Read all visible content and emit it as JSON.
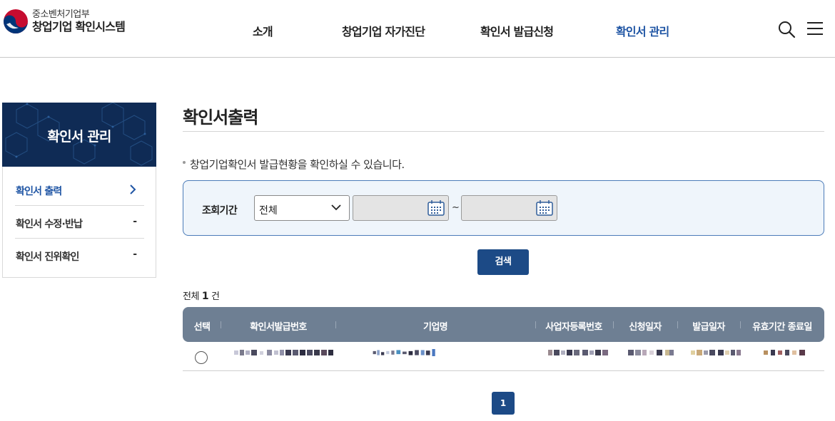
{
  "header": {
    "org_name": "중소벤처기업부",
    "site_name": "창업기업 확인시스템",
    "nav": [
      {
        "label": "소개"
      },
      {
        "label": "창업기업 자가진단"
      },
      {
        "label": "확인서 발급신청"
      },
      {
        "label": "확인서 관리",
        "active": true
      }
    ],
    "icons": [
      "search-icon",
      "menu-icon"
    ],
    "accent_color": "#1f55a4"
  },
  "sidebar": {
    "title": "확인서 관리",
    "items": [
      {
        "label": "확인서 출력",
        "active": true,
        "icon": "chevron-right-icon"
      },
      {
        "label": "확인서 수정·반납",
        "mark": "-"
      },
      {
        "label": "확인서 진위확인",
        "mark": "-"
      }
    ]
  },
  "main": {
    "title": "확인서출력",
    "description": "창업기업확인서 발급현황을 확인하실 수 있습니다.",
    "search": {
      "period_label": "조회기간",
      "period_select_value": "전체",
      "date_from": "",
      "date_to": "",
      "range_separator": "~",
      "button_label": "검색"
    },
    "total": {
      "prefix": "전체",
      "count": "1",
      "suffix": "건"
    },
    "table": {
      "columns": [
        "선택",
        "확인서발급번호",
        "기업명",
        "사업자등록번호",
        "신청일자",
        "발급일자",
        "유효기간 종료일"
      ],
      "rows": [
        {
          "selected": false,
          "cells": [
            "",
            "",
            "",
            "",
            "",
            ""
          ]
        }
      ]
    },
    "pagination": {
      "current_page": "1"
    }
  },
  "colors": {
    "navy": "#1c4a86",
    "table_header": "#6e7f93",
    "search_bg": "#eff5fb"
  }
}
